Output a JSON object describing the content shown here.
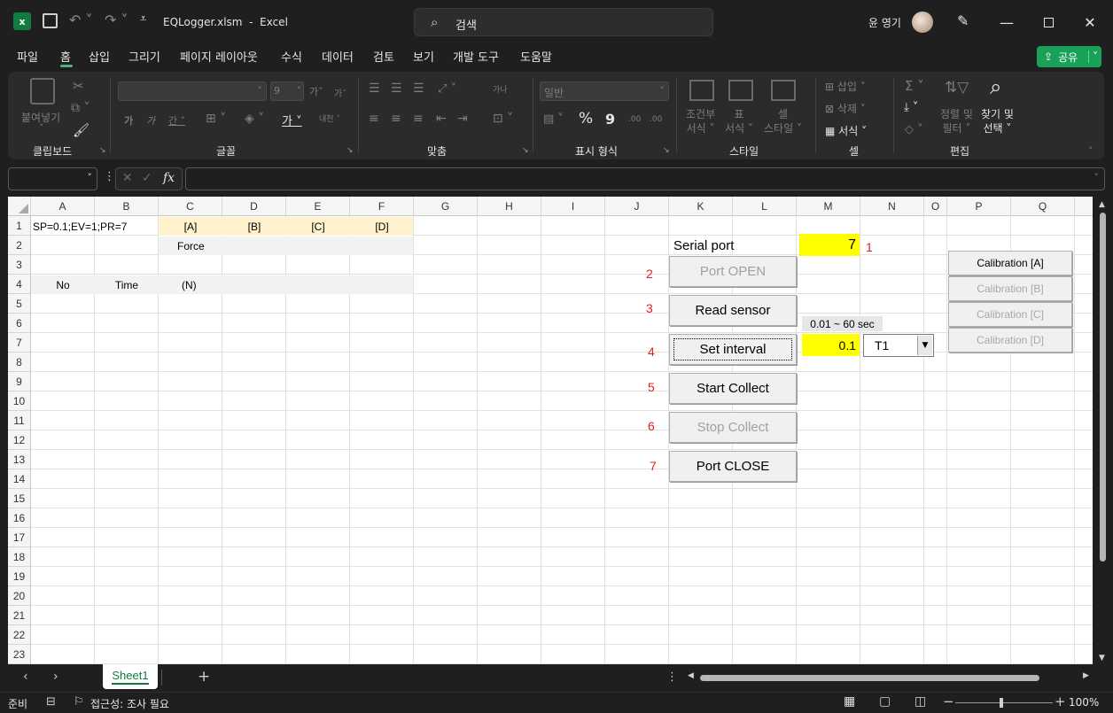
{
  "app": {
    "file_name": "EQLogger.xlsm",
    "separator": "-",
    "app_name": "Excel",
    "search_placeholder": "검색",
    "user_name": "윤 영기"
  },
  "menu": {
    "tabs": [
      "파일",
      "홈",
      "삽입",
      "그리기",
      "페이지 레이아웃",
      "수식",
      "데이터",
      "검토",
      "보기",
      "개발 도구",
      "도움말"
    ],
    "share_label": "공유"
  },
  "ribbon": {
    "clipboard": {
      "paste": "붙여넣기",
      "label": "클립보드"
    },
    "font": {
      "size": "9",
      "bold": "가",
      "italic": "가",
      "underline": "간",
      "grow": "가",
      "shrink": "가",
      "phonetic": "내천",
      "font_color": "가",
      "label": "글꼴"
    },
    "alignment": {
      "wrap": "가나",
      "label": "맞춤"
    },
    "number": {
      "format": "일반",
      "percent": "%",
      "comma": "9",
      "inc_decimal": ".00",
      "dec_decimal": ".00",
      "label": "표시 형식"
    },
    "styles": {
      "conditional_1": "조건부",
      "conditional_2": "서식",
      "table_1": "표",
      "table_2": "서식",
      "cell_1": "셀",
      "cell_2": "스타일",
      "label": "스타일"
    },
    "cells": {
      "insert": "삽입",
      "delete": "삭제",
      "format": "서식",
      "label": "셀"
    },
    "editing": {
      "sort_1": "정렬 및",
      "sort_2": "필터",
      "find_1": "찾기 및",
      "find_2": "선택",
      "label": "편집"
    }
  },
  "formula_bar": {
    "name_box": "",
    "formula": "",
    "fx": "fx"
  },
  "columns": [
    "A",
    "B",
    "C",
    "D",
    "E",
    "F",
    "G",
    "H",
    "I",
    "J",
    "K",
    "L",
    "M",
    "N",
    "O",
    "P",
    "Q"
  ],
  "rows": [
    "1",
    "2",
    "3",
    "4",
    "5",
    "6",
    "7",
    "8",
    "9",
    "10",
    "11",
    "12",
    "13",
    "14",
    "15",
    "16",
    "17",
    "18",
    "19",
    "20",
    "21",
    "22",
    "23"
  ],
  "cells": {
    "A1": "SP=0.1;EV=1;PR=7",
    "C1": "[A]",
    "D1": "[B]",
    "E1": "[C]",
    "F1": "[D]",
    "C2": "Force",
    "A4": "No",
    "B4": "Time",
    "C4": "(N)",
    "K2": "Serial port",
    "M2": "7",
    "M6": "0.01 ~ 60 sec",
    "M7": "0.1",
    "N7": "T1"
  },
  "colors": {
    "header_band": "#fff2cc",
    "label_band": "#f2f2f2",
    "input_yellow": "#ffff00",
    "step_red": "#e02020",
    "share_green": "#19a15a"
  },
  "buttons": {
    "port_open": "Port OPEN",
    "read_sensor": "Read sensor",
    "set_interval": "Set interval",
    "start_collect": "Start Collect",
    "stop_collect": "Stop Collect",
    "port_close": "Port CLOSE"
  },
  "steps": [
    "1",
    "2",
    "3",
    "4",
    "5",
    "6",
    "7"
  ],
  "calibration": [
    "Calibration [A]",
    "Calibration [B]",
    "Calibration [C]",
    "Calibration [D]"
  ],
  "sheets": {
    "active": "Sheet1",
    "add": "+"
  },
  "status": {
    "ready": "준비",
    "accessibility": "접근성: 조사 필요",
    "zoom": "100%"
  }
}
